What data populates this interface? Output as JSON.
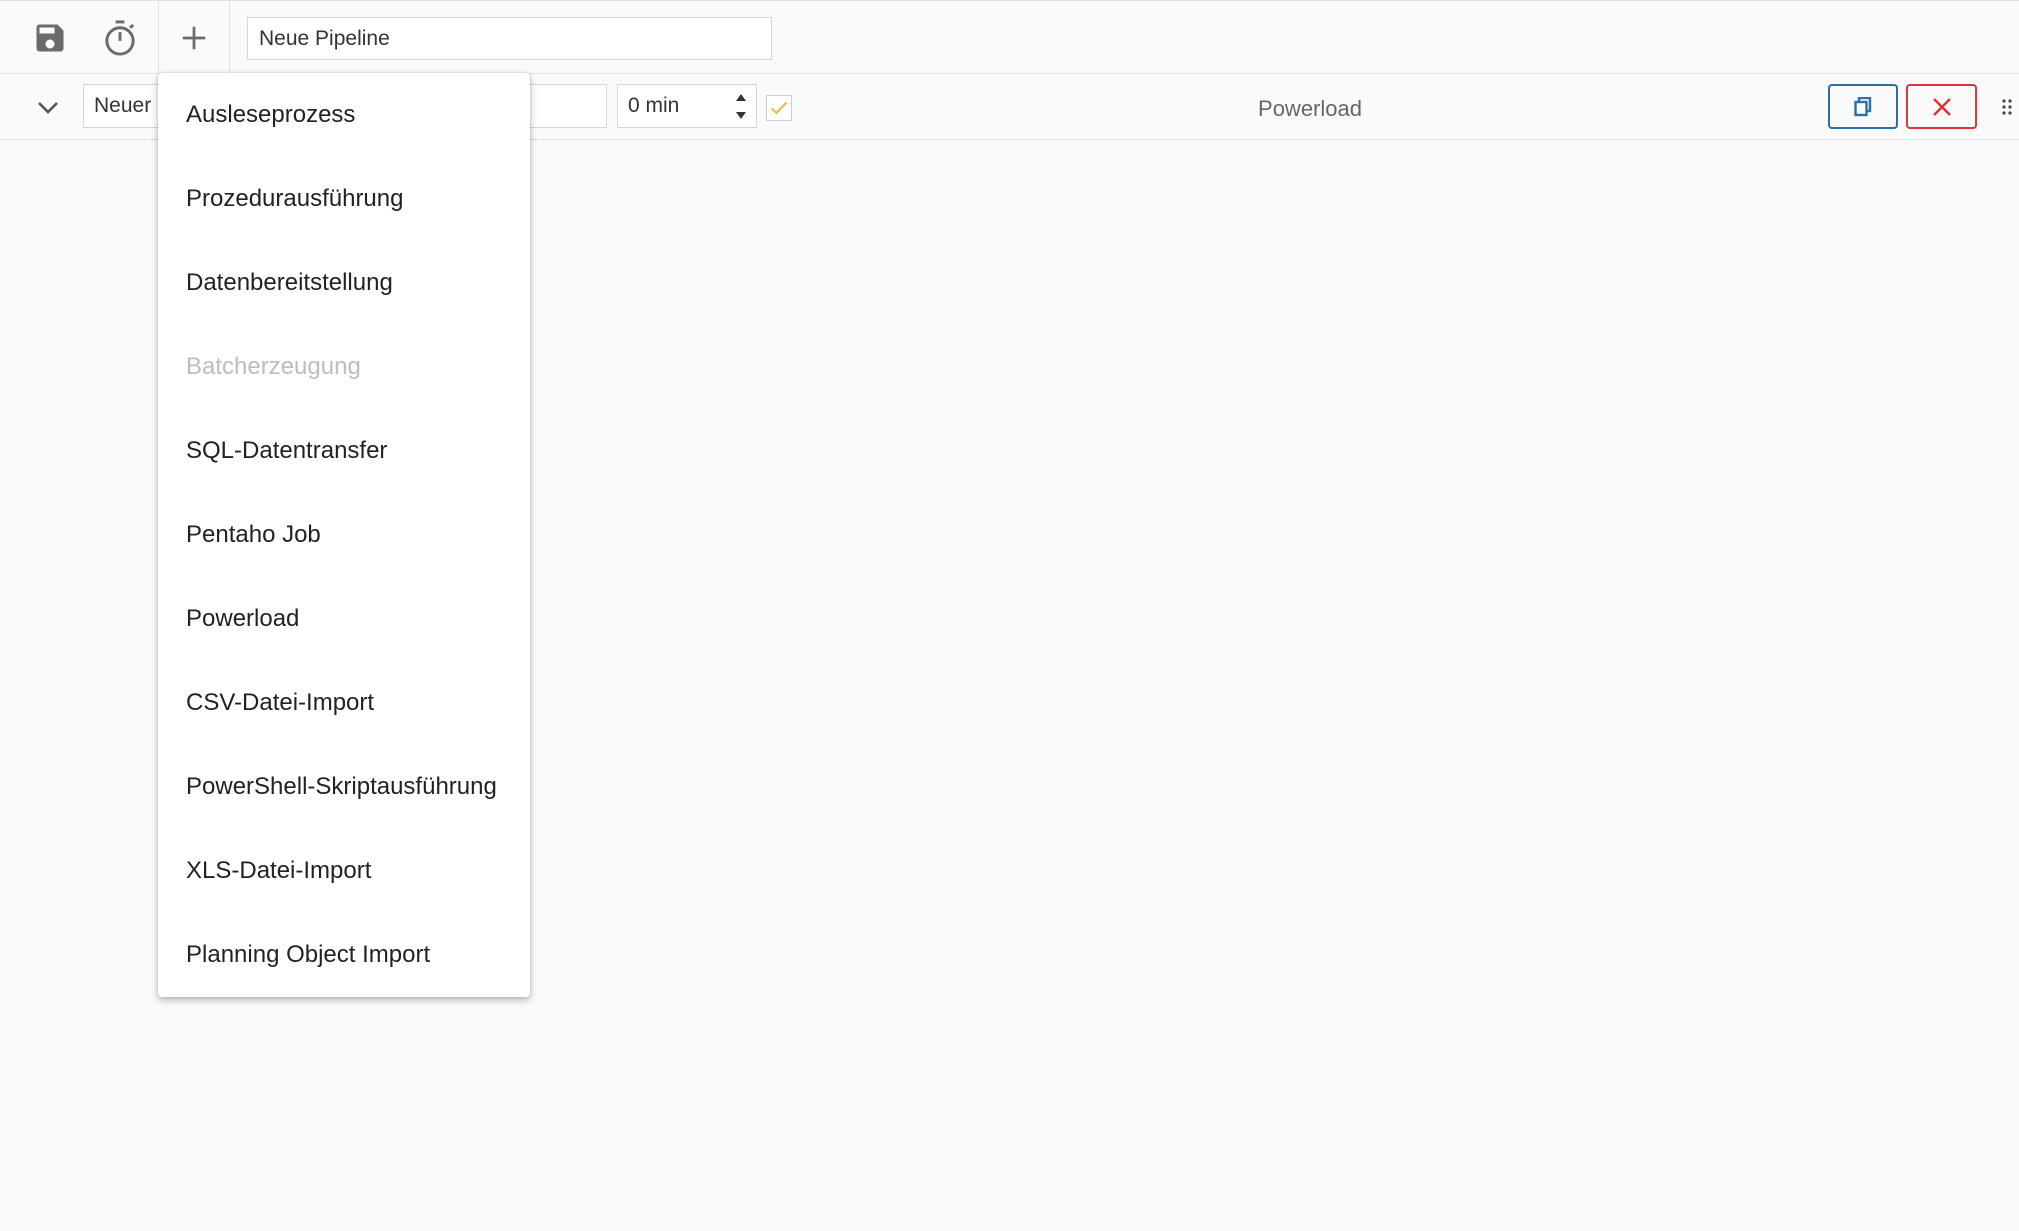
{
  "toolbar": {
    "save_icon": "floppy-disk-icon",
    "timer_icon": "stopwatch-icon",
    "add_icon": "plus-icon",
    "pipeline_name": "Neue Pipeline"
  },
  "step": {
    "name": "Neuer Schritt",
    "delay": "0 min",
    "enabled": true,
    "type": "Powerload",
    "copy_icon": "copy-icon",
    "remove_icon": "close-icon",
    "drag_icon": "drag-handle-icon"
  },
  "colors": {
    "accent_blue": "#2f6ea5",
    "danger_red": "#d9363e",
    "check_yellow": "#f5b82e",
    "icon_gray": "#6b6b6b"
  },
  "menu": {
    "items": [
      {
        "label": "Ausleseprozess",
        "disabled": false
      },
      {
        "label": "Prozedurausführung",
        "disabled": false
      },
      {
        "label": "Datenbereitstellung",
        "disabled": false
      },
      {
        "label": "Batcherzeugung",
        "disabled": true
      },
      {
        "label": "SQL-Datentransfer",
        "disabled": false
      },
      {
        "label": "Pentaho Job",
        "disabled": false
      },
      {
        "label": "Powerload",
        "disabled": false
      },
      {
        "label": "CSV-Datei-Import",
        "disabled": false
      },
      {
        "label": "PowerShell-Skriptausführung",
        "disabled": false
      },
      {
        "label": "XLS-Datei-Import",
        "disabled": false
      },
      {
        "label": "Planning Object Import",
        "disabled": false
      }
    ]
  }
}
